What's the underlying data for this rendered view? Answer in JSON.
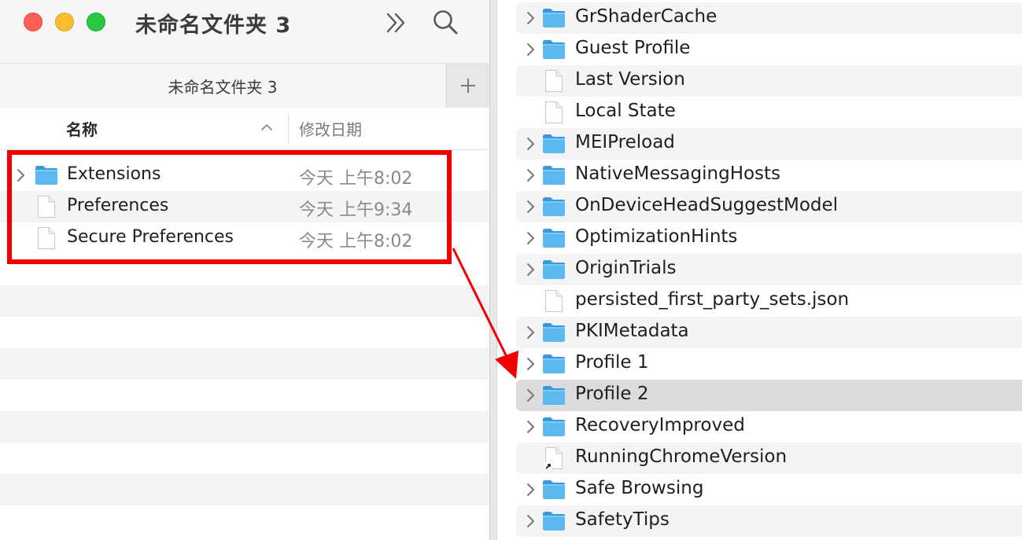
{
  "window": {
    "title": "未命名文件夹 3",
    "tab_label": "未命名文件夹 3",
    "add_tab_symbol": "+",
    "more_icon": "chevron-double-right-icon",
    "search_icon": "magnifier-icon"
  },
  "columns": {
    "name_header": "名称",
    "date_header": "修改日期",
    "sort": "ascending"
  },
  "left_files": [
    {
      "name": "Extensions",
      "date": "今天 上午8:02",
      "kind": "folder",
      "expandable": true
    },
    {
      "name": "Preferences",
      "date": "今天 上午9:34",
      "kind": "file",
      "expandable": false
    },
    {
      "name": "Secure Preferences",
      "date": "今天 上午8:02",
      "kind": "file",
      "expandable": false
    }
  ],
  "right_files": [
    {
      "name": "GrShaderCache",
      "kind": "folder",
      "expandable": true
    },
    {
      "name": "Guest Profile",
      "kind": "folder",
      "expandable": true
    },
    {
      "name": "Last Version",
      "kind": "file",
      "expandable": false
    },
    {
      "name": "Local State",
      "kind": "file",
      "expandable": false
    },
    {
      "name": "MEIPreload",
      "kind": "folder",
      "expandable": true
    },
    {
      "name": "NativeMessagingHosts",
      "kind": "folder",
      "expandable": true
    },
    {
      "name": "OnDeviceHeadSuggestModel",
      "kind": "folder",
      "expandable": true
    },
    {
      "name": "OptimizationHints",
      "kind": "folder",
      "expandable": true
    },
    {
      "name": "OriginTrials",
      "kind": "folder",
      "expandable": true
    },
    {
      "name": "persisted_first_party_sets.json",
      "kind": "file",
      "expandable": false
    },
    {
      "name": "PKIMetadata",
      "kind": "folder",
      "expandable": true
    },
    {
      "name": "Profile 1",
      "kind": "folder",
      "expandable": true
    },
    {
      "name": "Profile 2",
      "kind": "folder",
      "expandable": true,
      "selected": true
    },
    {
      "name": "RecoveryImproved",
      "kind": "folder",
      "expandable": true
    },
    {
      "name": "RunningChromeVersion",
      "kind": "alias",
      "expandable": false
    },
    {
      "name": "Safe Browsing",
      "kind": "folder",
      "expandable": true
    },
    {
      "name": "SafetyTips",
      "kind": "folder",
      "expandable": true
    }
  ],
  "colors": {
    "highlight": "#f20000",
    "folder": "#4fb2ec",
    "selected_row": "#dcdcdc"
  }
}
